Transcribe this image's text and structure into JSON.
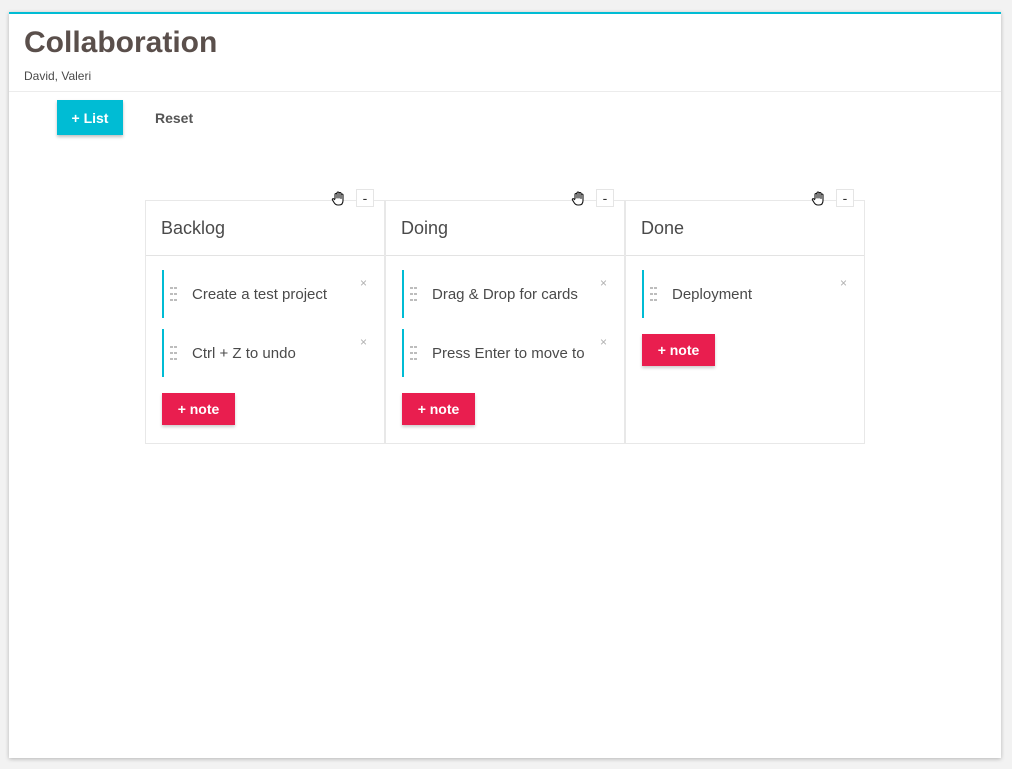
{
  "header": {
    "title": "Collaboration",
    "subtitle": "David, Valeri"
  },
  "toolbar": {
    "add_list_label": "+ List",
    "reset_label": "Reset"
  },
  "columns": [
    {
      "title": "Backlog",
      "collapse_label": "-",
      "add_note_label": "+ note",
      "cards": [
        {
          "text": "Create a test project",
          "close": "×"
        },
        {
          "text": "Ctrl + Z to undo",
          "close": "×"
        }
      ]
    },
    {
      "title": "Doing",
      "collapse_label": "-",
      "add_note_label": "+ note",
      "cards": [
        {
          "text": "Drag & Drop for cards",
          "close": "×"
        },
        {
          "text": "Press Enter to move to",
          "close": "×"
        }
      ]
    },
    {
      "title": "Done",
      "collapse_label": "-",
      "add_note_label": "+ note",
      "cards": [
        {
          "text": "Deployment",
          "close": "×"
        }
      ]
    }
  ],
  "colors": {
    "accent": "#00bcd4",
    "note_button": "#e91e4f",
    "title_text": "#5a4f4b"
  },
  "icons": {
    "column_drag": "hand-icon",
    "card_drag": "drag-handle-icon"
  }
}
